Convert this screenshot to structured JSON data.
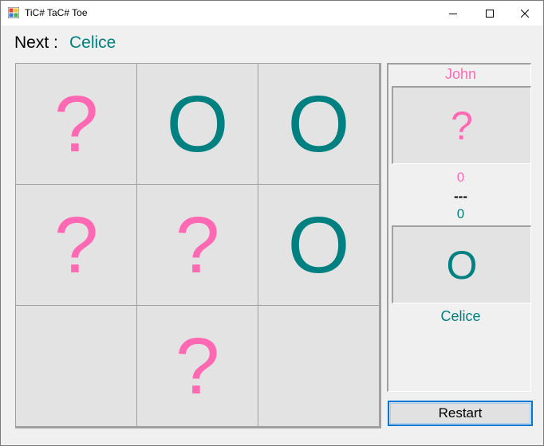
{
  "window": {
    "title": "TiC# TaC# Toe",
    "icon": "tictactoe-app-icon",
    "controls": [
      "minimize-icon",
      "maximize-icon",
      "close-icon"
    ]
  },
  "status": {
    "next_label": "Next :",
    "next_player": "Celice"
  },
  "board": {
    "cells": [
      "?",
      "O",
      "O",
      "?",
      "?",
      "O",
      "",
      "?",
      ""
    ]
  },
  "players": {
    "player1": {
      "name": "John",
      "symbol": "?",
      "score": "0"
    },
    "player2": {
      "name": "Celice",
      "symbol": "O",
      "score": "0"
    },
    "separator": "---"
  },
  "restart_label": "Restart",
  "colors": {
    "player1": "#ff69b4",
    "player2": "#008080",
    "cell_bg": "#e3e3e3",
    "window_bg": "#f0f0f0"
  }
}
